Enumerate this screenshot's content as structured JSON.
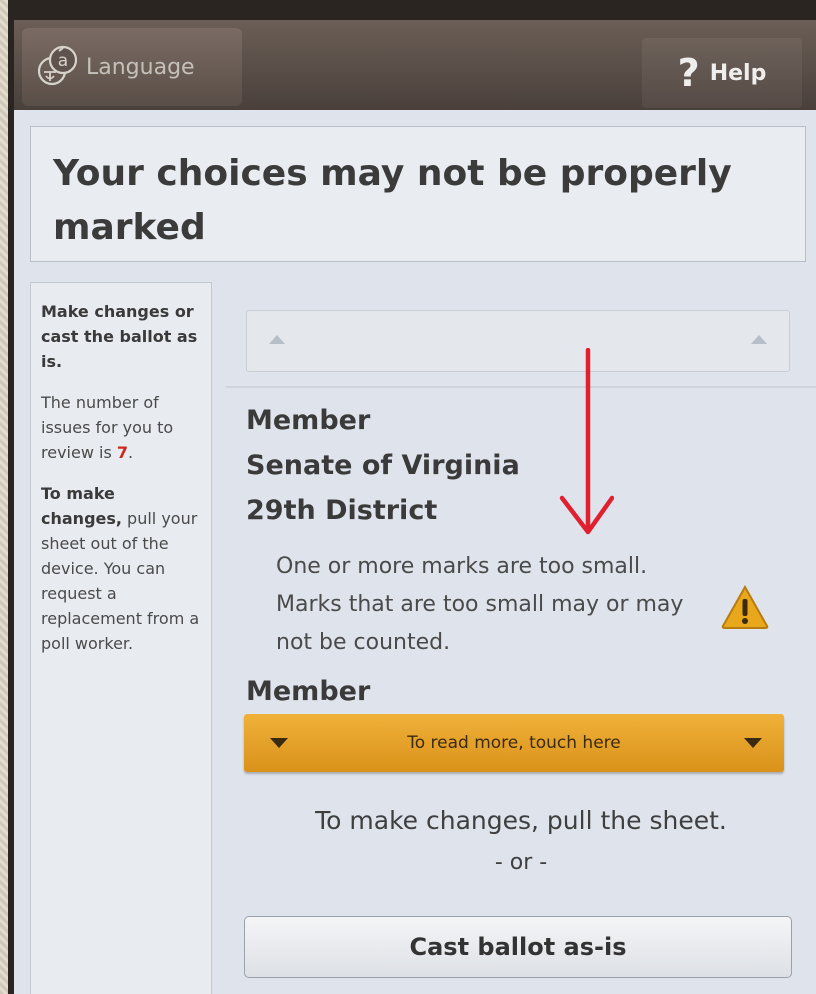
{
  "topbar": {
    "language_label": "Language",
    "help_label": "Help",
    "help_glyph": "?"
  },
  "header": {
    "title": "Your choices may not be properly marked"
  },
  "sidebar": {
    "intro": "Make changes or cast the ballot as is.",
    "count_prefix": "The number of issues for you to review is ",
    "count_value": "7",
    "count_suffix": ".",
    "changes_bold": "To make changes,",
    "changes_text": " pull your sheet out of the device. You can request a replacement from a poll worker."
  },
  "contest": {
    "line1": "Member",
    "line2": "Senate of Virginia",
    "line3": "29th District",
    "warning": "One or more marks are too small. Marks that are too small may or may not be counted.",
    "next_title": "Member"
  },
  "read_more_label": "To read more, touch here",
  "instructions": {
    "changes": "To make changes, pull the sheet.",
    "or": "- or -"
  },
  "cast_button_label": "Cast ballot as-is",
  "colors": {
    "accent": "#e5a12a",
    "warning_count": "#d0271d",
    "annotation_arrow": "#e0202e"
  }
}
